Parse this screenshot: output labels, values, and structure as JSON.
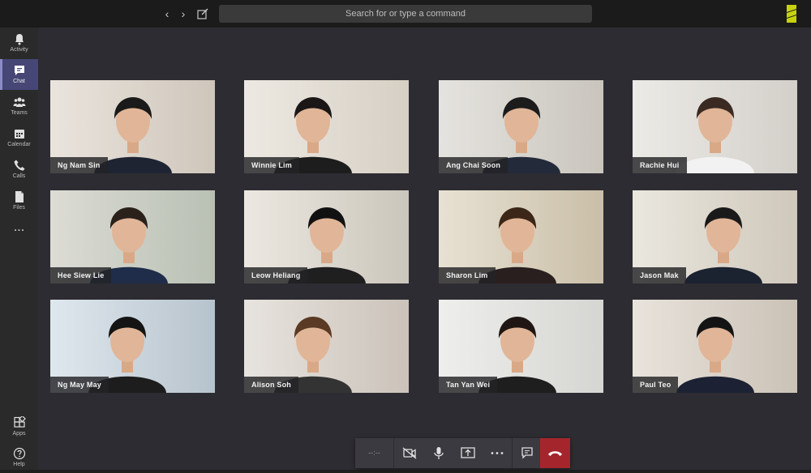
{
  "search": {
    "placeholder": "Search for or type a command"
  },
  "rail": {
    "items": [
      {
        "label": "Activity",
        "icon": "bell-icon"
      },
      {
        "label": "Chat",
        "icon": "chat-icon",
        "active": true
      },
      {
        "label": "Teams",
        "icon": "teams-icon"
      },
      {
        "label": "Calendar",
        "icon": "calendar-icon"
      },
      {
        "label": "Calls",
        "icon": "phone-icon"
      },
      {
        "label": "Files",
        "icon": "file-icon"
      }
    ],
    "more": "...",
    "bottom": [
      {
        "label": "Apps",
        "icon": "apps-icon"
      },
      {
        "label": "Help",
        "icon": "help-icon"
      }
    ]
  },
  "participants": [
    {
      "name": "Ng Nam Sin"
    },
    {
      "name": "Winnie Lim"
    },
    {
      "name": "Ang Chai Soon"
    },
    {
      "name": "Rachie Hui"
    },
    {
      "name": "Hee Siew Lie"
    },
    {
      "name": "Leow Heliang"
    },
    {
      "name": "Sharon Lim"
    },
    {
      "name": "Jason Mak"
    },
    {
      "name": "Ng May May"
    },
    {
      "name": "Alison Soh"
    },
    {
      "name": "Tan Yan Wei"
    },
    {
      "name": "Paul Teo"
    }
  ],
  "controls": {
    "timer": "--:--"
  },
  "colors": {
    "accent": "#464775",
    "hangup": "#a4262c",
    "logo": "#c6d30c"
  }
}
